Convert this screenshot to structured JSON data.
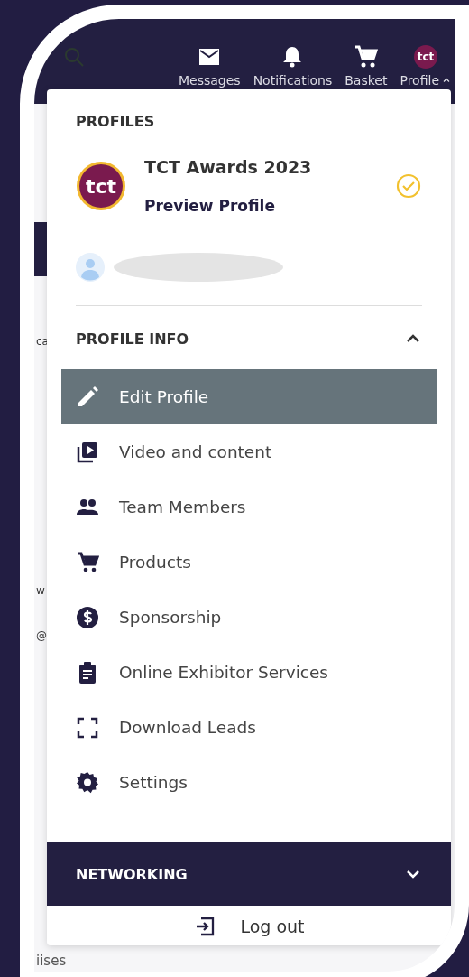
{
  "header": {
    "nav": [
      {
        "kind": "messages",
        "label": "Messages"
      },
      {
        "kind": "notifications",
        "label": "Notifications"
      },
      {
        "kind": "basket",
        "label": "Basket"
      },
      {
        "kind": "profile",
        "label": "Profile",
        "avatar_text": "tct",
        "expanded": true
      }
    ]
  },
  "background_fragments": [
    "ca",
    "w",
    "@",
    "iises"
  ],
  "menu": {
    "profiles_title": "PROFILES",
    "profiles": [
      {
        "kind": "organisation",
        "logo_text": "tct",
        "name": "TCT Awards 2023",
        "subtitle": "Preview Profile",
        "selected": true
      },
      {
        "kind": "person",
        "selected": false
      }
    ],
    "sections": [
      {
        "title": "PROFILE INFO",
        "expanded": true,
        "items": [
          {
            "kind": "edit",
            "label": "Edit Profile",
            "selected": true
          },
          {
            "kind": "video",
            "label": "Video and content",
            "selected": false
          },
          {
            "kind": "team",
            "label": "Team Members",
            "selected": false
          },
          {
            "kind": "products",
            "label": "Products",
            "selected": false
          },
          {
            "kind": "sponsorship",
            "label": "Sponsorship",
            "selected": false
          },
          {
            "kind": "services",
            "label": "Online Exhibitor Services",
            "selected": false
          },
          {
            "kind": "leads",
            "label": "Download Leads",
            "selected": false
          },
          {
            "kind": "settings",
            "label": "Settings",
            "selected": false
          }
        ]
      },
      {
        "title": "NETWORKING",
        "expanded": false
      }
    ],
    "logout": "Log out"
  }
}
